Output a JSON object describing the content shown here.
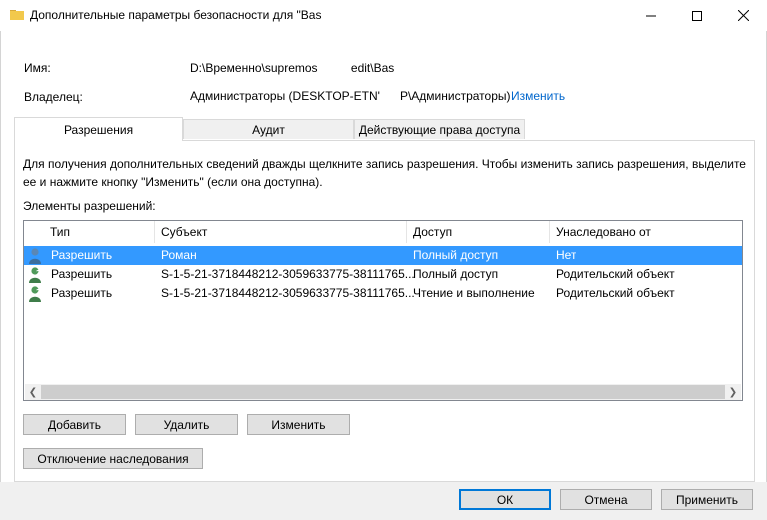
{
  "window": {
    "title": "Дополнительные параметры безопасности  для \"Bas",
    "minimize_glyph": "—",
    "maximize_glyph": "☐",
    "close_glyph": "✕"
  },
  "info": {
    "name_label": "Имя:",
    "name_value": "D:\\Временно\\supremos          edit\\Bas",
    "owner_label": "Владелец:",
    "owner_value": "Администраторы (DESKTOP-ETN'      P\\Администраторы)",
    "change_link": "Изменить"
  },
  "tabs": [
    {
      "label": "Разрешения",
      "active": true
    },
    {
      "label": "Аудит",
      "active": false
    },
    {
      "label": "Действующие права доступа",
      "active": false
    }
  ],
  "description": {
    "line1": "Для получения дополнительных сведений дважды щелкните запись разрешения. Чтобы изменить запись разрешения, выделите",
    "line2": "ее и нажмите кнопку \"Изменить\" (если она доступна)."
  },
  "entries_label": "Элементы разрешений:",
  "table": {
    "columns": [
      "Тип",
      "Субъект",
      "Доступ",
      "Унаследовано от"
    ],
    "rows": [
      {
        "type": "Разрешить",
        "subject": "Роман",
        "access": "Полный доступ",
        "inherited": "Нет",
        "selected": true
      },
      {
        "type": "Разрешить",
        "subject": "S-1-5-21-3718448212-3059633775-38111765...",
        "access": "Полный доступ",
        "inherited": "Родительский объект",
        "selected": false
      },
      {
        "type": "Разрешить",
        "subject": "S-1-5-21-3718448212-3059633775-38111765...",
        "access": "Чтение и выполнение",
        "inherited": "Родительский объект",
        "selected": false
      }
    ]
  },
  "buttons": {
    "add": "Добавить",
    "remove": "Удалить",
    "edit": "Изменить",
    "disable_inheritance": "Отключение наследования",
    "ok": "ОК",
    "cancel": "Отмена",
    "apply": "Применить"
  },
  "colors": {
    "selection": "#3399ff",
    "link": "#0066cc",
    "default_button_border": "#0078d7"
  }
}
